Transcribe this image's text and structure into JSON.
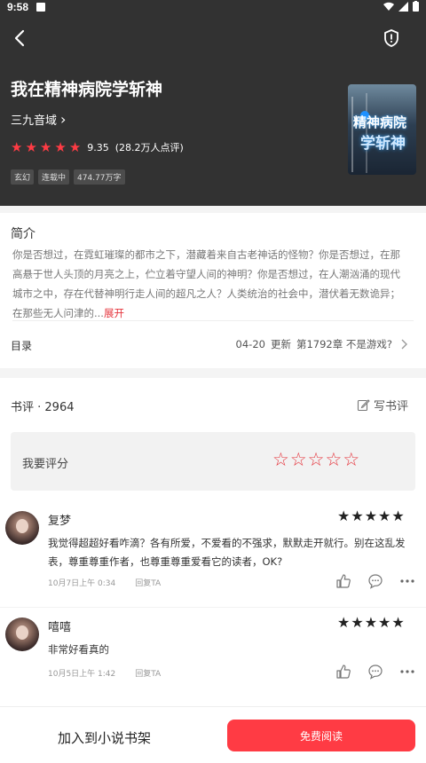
{
  "status_bar": {
    "time": "9:58"
  },
  "book": {
    "title": "我在精神病院学斩神",
    "author": "三九音域",
    "author_arrow": "›",
    "rating_score": "9.35",
    "rating_count": "(28.2万人点评)",
    "stars_filled": 5,
    "tags": [
      "玄幻",
      "连载中",
      "474.77万字"
    ],
    "cover_text_line1": "精神病院",
    "cover_text_line2": "学斩神"
  },
  "intro": {
    "heading": "简介",
    "text": "你是否想过，在霓虹璀璨的都市之下，潜藏着来自古老神话的怪物？你是否想过，在那高悬于世人头顶的月亮之上，伫立着守望人间的神明？你是否想过，在人潮汹涌的现代城市之中，存在代替神明行走人间的超凡之人？人类统治的社会中，潜伏着无数诡异；在那些无人问津的...",
    "more": "展开"
  },
  "toc": {
    "label": "目录",
    "date": "04-20",
    "update_label": "更新",
    "latest_chapter": "第1792章 不是游戏?"
  },
  "reviews": {
    "heading": "书评 · 2964",
    "write_label": "写书评",
    "rate_prompt": "我要评分",
    "items": [
      {
        "name": "复梦",
        "stars": 5,
        "text": "我觉得超超好看咋滴？各有所爱，不爱看的不强求，默默走开就行。别在这乱发表，尊重尊重作者，也尊重尊重爱看它的读者，OK?",
        "time": "10月7日上午 0:34",
        "reply_label": "回复TA"
      },
      {
        "name": "嘻嘻",
        "stars": 5,
        "text": "非常好看真的",
        "time": "10月5日上午 1:42",
        "reply_label": "回复TA"
      }
    ]
  },
  "bottom": {
    "add_shelf_label": "加入到小说书架",
    "read_label": "免费阅读",
    "accent_color": "#ff3b44"
  }
}
